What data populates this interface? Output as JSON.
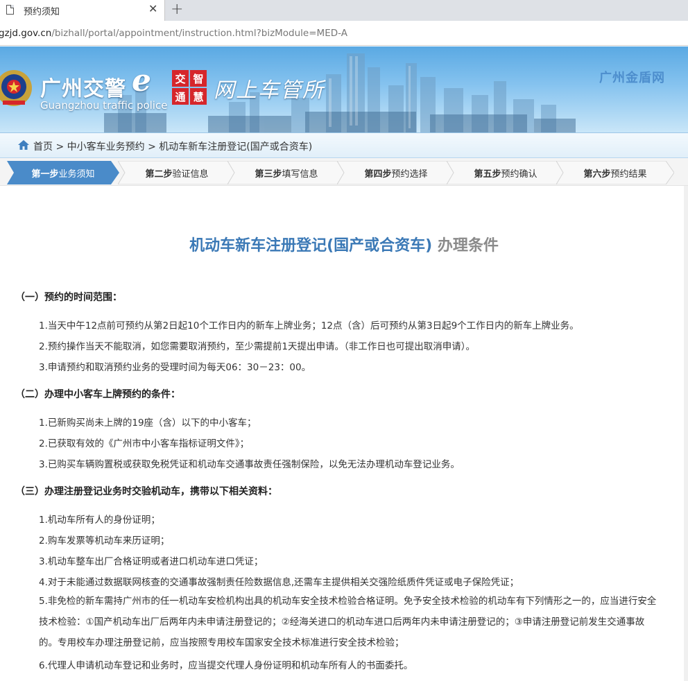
{
  "browser": {
    "tab_title": "预约须知",
    "close_symbol": "✕",
    "newtab_symbol": "+",
    "url_host": "gzjd.gov.cn",
    "url_path": "/bizhall/portal/appointment/instruction.html?bizModule=MED-A"
  },
  "banner": {
    "brand_cn": "广州交警",
    "brand_e": "e",
    "brand_en": "Guangzhou traffic police",
    "seal_chars": [
      "交",
      "智",
      "通",
      "慧"
    ],
    "hall": "网上车管所",
    "gold_shield": "广州金盾网"
  },
  "breadcrumb": {
    "items": [
      "首页",
      "中小客车业务预约",
      "机动车新车注册登记(国产或合资车)"
    ],
    "separator": " > "
  },
  "steps": [
    {
      "bold": "第一步",
      "text": "业务须知",
      "active": true
    },
    {
      "bold": "第二步",
      "text": "验证信息",
      "active": false
    },
    {
      "bold": "第三步",
      "text": "填写信息",
      "active": false
    },
    {
      "bold": "第四步",
      "text": "预约选择",
      "active": false
    },
    {
      "bold": "第五步",
      "text": "预约确认",
      "active": false
    },
    {
      "bold": "第六步",
      "text": "预约结果",
      "active": false
    }
  ],
  "colors": {
    "active_step": "#4a8bc9",
    "headline_blue": "#3b79b6",
    "headline_gray": "#8a8a8a"
  },
  "content": {
    "title_main": "机动车新车注册登记(国产或合资车)",
    "title_suffix": " 办理条件",
    "sections": [
      {
        "heading": "（一）预约的时间范围：",
        "items": [
          "1.当天中午12点前可预约从第2日起10个工作日内的新车上牌业务；12点（含）后可预约从第3日起9个工作日内的新车上牌业务。",
          "2.预约操作当天不能取消，如您需要取消预约，至少需提前1天提出申请。（非工作日也可提出取消申请）。",
          "3.申请预约和取消预约业务的受理时间为每天06：30－23：00。"
        ]
      },
      {
        "heading": "（二）办理中小客车上牌预约的条件：",
        "items": [
          "1.已新购买尚未上牌的19座（含）以下的中小客车；",
          "2.已获取有效的《广州市中小客车指标证明文件》；",
          "3.已购买车辆购置税或获取免税凭证和机动车交通事故责任强制保险，以免无法办理机动车登记业务。"
        ]
      },
      {
        "heading": "（三）办理注册登记业务时交验机动车，携带以下相关资料：",
        "items": [
          "1.机动车所有人的身份证明；",
          "2.购车发票等机动车来历证明；",
          "3.机动车整车出厂合格证明或者进口机动车进口凭证；",
          "4.对于未能通过数据联网核查的交通事故强制责任险数据信息,还需车主提供相关交强险纸质件凭证或电子保险凭证；",
          "5.非免检的新车需持广州市的任一机动车安检机构出具的机动车安全技术检验合格证明。免予安全技术检验的机动车有下列情形之一的，应当进行安全技术检验：①国产机动车出厂后两年内未申请注册登记的；②经海关进口的机动车进口后两年内未申请注册登记的；③申请注册登记前发生交通事故的。专用校车办理注册登记前，应当按照专用校车国家安全技术标准进行安全技术检验；",
          "6.代理人申请机动车登记和业务时，应当提交代理人身份证明和机动车所有人的书面委托。"
        ]
      }
    ]
  }
}
